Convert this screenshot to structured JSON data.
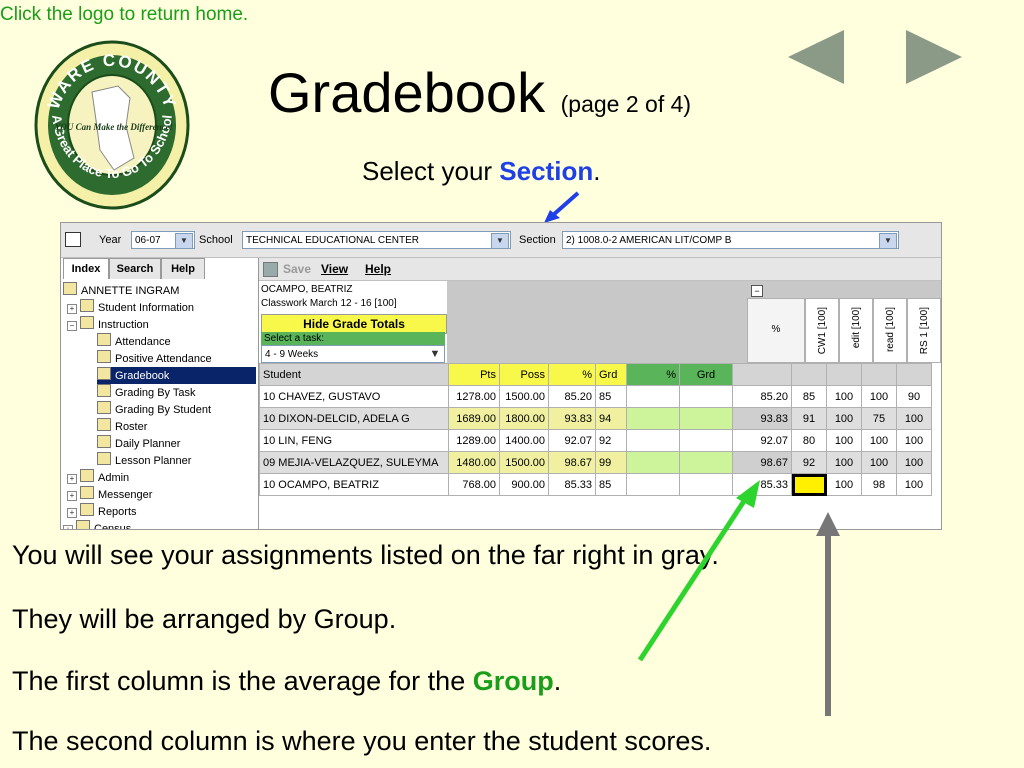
{
  "hint": "Click the logo to return home.",
  "logo": {
    "ring_top": "WARE COUNTY",
    "ring_bottom": "A Great Place To Go To School",
    "center": "YOU Can Make the Difference!"
  },
  "title": {
    "main": "Gradebook",
    "sub": "(page 2 of 4)"
  },
  "subtitle": {
    "pre": "Select your ",
    "highlight": "Section",
    "post": "."
  },
  "nav": {
    "prev": "◀",
    "next": "▶"
  },
  "app": {
    "year_label": "Year",
    "year_value": "06-07",
    "school_label": "School",
    "school_value": "TECHNICAL EDUCATIONAL CENTER",
    "section_label": "Section",
    "section_value": "2) 1008.0-2 AMERICAN LIT/COMP B",
    "tabs": [
      "Index",
      "Search",
      "Help"
    ],
    "tree": [
      {
        "label": "ANNETTE INGRAM",
        "level": 0
      },
      {
        "label": "Student Information",
        "level": 1,
        "pm": "+"
      },
      {
        "label": "Instruction",
        "level": 1,
        "pm": "−"
      },
      {
        "label": "Attendance",
        "level": 2
      },
      {
        "label": "Positive Attendance",
        "level": 2
      },
      {
        "label": "Gradebook",
        "level": 2,
        "selected": true
      },
      {
        "label": "Grading By Task",
        "level": 2
      },
      {
        "label": "Grading By Student",
        "level": 2
      },
      {
        "label": "Roster",
        "level": 2
      },
      {
        "label": "Daily Planner",
        "level": 2
      },
      {
        "label": "Lesson Planner",
        "level": 2
      },
      {
        "label": "Admin",
        "level": 1,
        "pm": "+"
      },
      {
        "label": "Messenger",
        "level": 1,
        "pm": "+"
      },
      {
        "label": "Reports",
        "level": 1,
        "pm": "+"
      },
      {
        "label": "Census",
        "level": 0,
        "pm": "+"
      }
    ],
    "toolbar": {
      "save": "Save",
      "view": "View",
      "help": "Help"
    },
    "info_line1": "OCAMPO, BEATRIZ",
    "info_line2": "Classwork March 12 - 16 [100]",
    "hide_button": "Hide Grade Totals",
    "task_label": "Select a task:",
    "task_value": "4 - 9 Weeks",
    "collapse": "−",
    "columns": {
      "student": "Student",
      "pts": "Pts",
      "poss": "Poss",
      "pct": "%",
      "grd": "Grd",
      "pct2": "%",
      "grd2": "Grd",
      "avg": "%"
    },
    "assignments": [
      "CW1 [100]",
      "edit [100]",
      "read [100]",
      "RS 1 [100]"
    ],
    "rows": [
      {
        "student": "10 CHAVEZ, GUSTAVO",
        "pts": "1278.00",
        "poss": "1500.00",
        "pct": "85.20",
        "grd": "85",
        "avg": "85.20",
        "scores": [
          "85",
          "100",
          "100",
          "90"
        ]
      },
      {
        "student": "10 DIXON-DELCID, ADELA G",
        "pts": "1689.00",
        "poss": "1800.00",
        "pct": "93.83",
        "grd": "94",
        "avg": "93.83",
        "scores": [
          "91",
          "100",
          "75",
          "100"
        ]
      },
      {
        "student": "10 LIN, FENG",
        "pts": "1289.00",
        "poss": "1400.00",
        "pct": "92.07",
        "grd": "92",
        "avg": "92.07",
        "scores": [
          "80",
          "100",
          "100",
          "100"
        ]
      },
      {
        "student": "09 MEJIA-VELAZQUEZ, SULEYMA",
        "pts": "1480.00",
        "poss": "1500.00",
        "pct": "98.67",
        "grd": "99",
        "avg": "98.67",
        "scores": [
          "92",
          "100",
          "100",
          "100"
        ]
      },
      {
        "student": "10 OCAMPO, BEATRIZ",
        "pts": "768.00",
        "poss": "900.00",
        "pct": "85.33",
        "grd": "85",
        "avg": "85.33",
        "scores": [
          "",
          "100",
          "98",
          "100"
        ]
      }
    ]
  },
  "notes": {
    "line1": "You will see your assignments listed on the far right in gray.",
    "line2": "They will be arranged by Group.",
    "line3_pre": "The first column is the average for the ",
    "line3_highlight": "Group",
    "line3_post": ".",
    "line4": "The second column is where you enter the student scores."
  },
  "colors": {
    "highlight_green": "#1a9e1a",
    "highlight_blue": "#1f40e6",
    "cell_yellow": "#f8f84a",
    "selection_navy": "#0a246a"
  }
}
